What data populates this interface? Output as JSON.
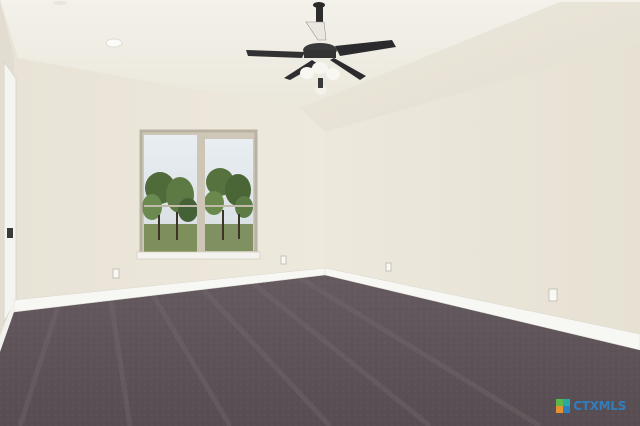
{
  "scene": {
    "description_tag": "empty-bedroom-photo",
    "colors": {
      "ceiling": "#f1efe7",
      "left_wall": "#ebe6d9",
      "right_wall": "#e8e3d5",
      "carpet": "#5b5257",
      "baseboard": "#f6f6f3",
      "window_frame": "#c9c3b4"
    }
  },
  "watermark": {
    "brand_part1": "CTX",
    "brand_part2": "MLS",
    "colors": {
      "green": "#5db84a",
      "blue": "#2e7fc0",
      "orange": "#e8912d",
      "teal": "#2aa9a0"
    }
  }
}
